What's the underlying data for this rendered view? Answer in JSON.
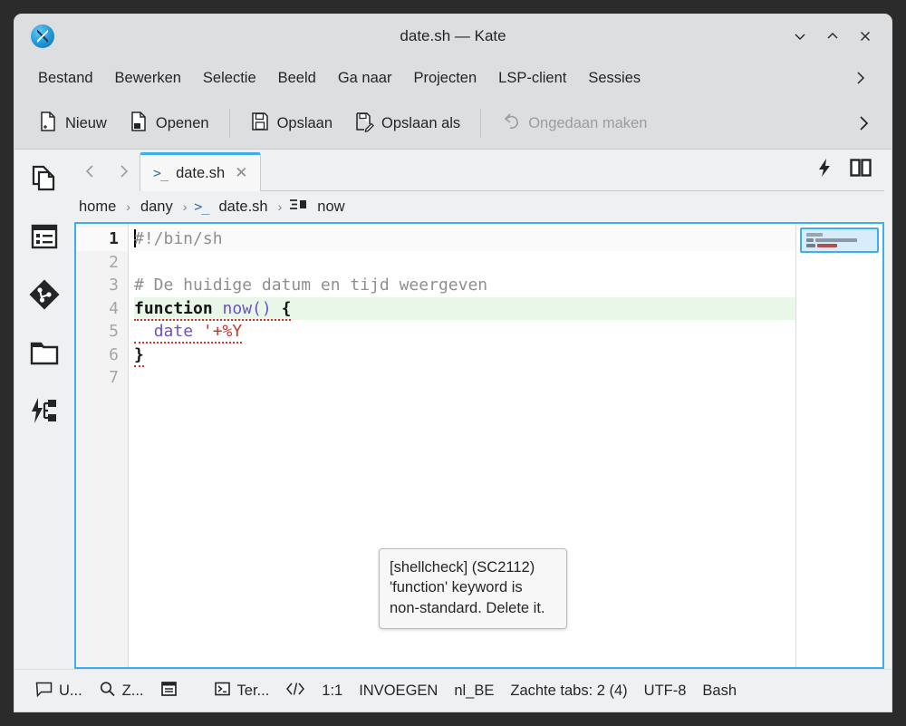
{
  "window": {
    "title": "date.sh — Kate",
    "logo_icon": "kate-logo-icon",
    "minimize_label": "⌄",
    "maximize_label": "⌃",
    "close_label": "✕"
  },
  "menubar": {
    "items": [
      {
        "label": "Bestand"
      },
      {
        "label": "Bewerken"
      },
      {
        "label": "Selectie"
      },
      {
        "label": "Beeld"
      },
      {
        "label": "Ga naar"
      },
      {
        "label": "Projecten"
      },
      {
        "label": "LSP-client"
      },
      {
        "label": "Sessies"
      }
    ],
    "overflow_label": "›"
  },
  "toolbar": {
    "new_label": "Nieuw",
    "open_label": "Openen",
    "save_label": "Opslaan",
    "save_as_label": "Opslaan als",
    "undo_label": "Ongedaan maken",
    "overflow_label": "›"
  },
  "sidebar": {
    "items": [
      {
        "name": "documents-icon",
        "tooltip": "Documenten"
      },
      {
        "name": "outline-icon",
        "tooltip": "Overzicht"
      },
      {
        "name": "git-icon",
        "tooltip": "Git"
      },
      {
        "name": "filesystem-icon",
        "tooltip": "Bestandssysteem"
      },
      {
        "name": "lsp-symbols-icon",
        "tooltip": "LSP-symbolen"
      }
    ]
  },
  "tabs": {
    "back_label": "‹",
    "forward_label": "›",
    "active": {
      "icon": "shell-script-icon",
      "icon_glyph": ">_",
      "label": "date.sh",
      "close_label": "✕"
    }
  },
  "breadcrumb": {
    "separator": "›",
    "items": [
      {
        "label": "home",
        "icon": ""
      },
      {
        "label": "dany",
        "icon": ""
      },
      {
        "label": "date.sh",
        "icon": ">_"
      },
      {
        "label": "now",
        "icon": "function-symbol"
      }
    ]
  },
  "editor": {
    "line_numbers": [
      "1",
      "2",
      "3",
      "4",
      "5",
      "6",
      "7"
    ],
    "current_line_number": "1",
    "highlighted_line_number": "4",
    "lines": [
      {
        "n": "1",
        "text": "#!/bin/sh"
      },
      {
        "n": "2",
        "text": ""
      },
      {
        "n": "3",
        "text": "# De huidige datum en tijd weergeven"
      },
      {
        "n": "4",
        "text": "function now() {"
      },
      {
        "n": "5",
        "text": "  date '+%Y"
      },
      {
        "n": "6",
        "text": "}"
      },
      {
        "n": "7",
        "text": ""
      }
    ],
    "tokens": {
      "l1_comment": "#!/bin/sh",
      "l3_comment": "# De huidige datum en tijd weergeven",
      "l4_keyword": "function",
      "l4_name": " now()",
      "l4_brace": " {",
      "l5_indent": "  ",
      "l5_cmd": "date",
      "l5_string": " '+%Y",
      "l6_brace": "}"
    }
  },
  "tooltip": {
    "line1": "[shellcheck] (SC2112)",
    "line2": "'function' keyword is non-standard. Delete it."
  },
  "editor_actions": {
    "lsp_label": "⚡",
    "split_label": "▯▯"
  },
  "statusbar": {
    "items": [
      {
        "name": "messages",
        "icon": "speech-bubble-icon",
        "label": "U..."
      },
      {
        "name": "search",
        "icon": "magnifier-icon",
        "label": "Z..."
      },
      {
        "name": "panel",
        "icon": "panel-icon",
        "label": ""
      },
      {
        "name": "terminal",
        "icon": "terminal-icon",
        "label": "Ter..."
      },
      {
        "name": "code",
        "icon": "code-brackets-icon",
        "label": ""
      }
    ],
    "cursor_position": "1:1",
    "input_mode": "INVOEGEN",
    "language_locale": "nl_BE",
    "tab_setting": "Zachte tabs: 2 (4)",
    "encoding": "UTF-8",
    "highlight_mode": "Bash"
  },
  "colors": {
    "accent": "#3daee9",
    "titlebar_bg": "#dcdee0",
    "chrome_bg": "#eff0f1",
    "current_line_bg": "#e9f7e9",
    "error_underline": "#d32f2f",
    "comment": "#8d8f91",
    "string": "#c0392b",
    "function": "#6c51c4"
  }
}
